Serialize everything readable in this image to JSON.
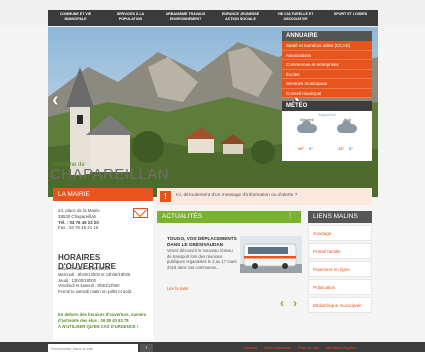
{
  "nav": [
    {
      "line1": "Commune et vie",
      "line2": "municipale"
    },
    {
      "line1": "Services à la",
      "line2": "population"
    },
    {
      "line1": "Urbanisme travaux",
      "line2": "environnement"
    },
    {
      "line1": "Enfance jeunesse",
      "line2": "action sociale"
    },
    {
      "line1": "Vie culturelle et",
      "line2": "associative"
    },
    {
      "line1": "Sport et loisirs",
      "line2": ""
    }
  ],
  "logo": {
    "small": "commune de",
    "big": "CHAPAREILLAN"
  },
  "annuaire": {
    "title": "Annuaire",
    "links": [
      "Santé et numéros utiles (CCAS)",
      "Associations",
      "Commerces et entreprises",
      "Écoles",
      "Services municipaux",
      "Conseil municipal"
    ]
  },
  "meteo": {
    "title": "MÉTÉO",
    "updated": "Aujourd'hui",
    "days": [
      {
        "name": "Mercredi",
        "low": "10°",
        "high": "6°"
      },
      {
        "name": "Jeudi",
        "low": "13°",
        "high": "5°"
      }
    ]
  },
  "mairie": {
    "title": "La mairie",
    "address": [
      "24, place de la Mairie",
      "38530 Chapareillan",
      "Tél. : 04 76 45 22 20",
      "Fax : 04 76 45 21 16"
    ],
    "hours_title": "Horaires d'ouverture",
    "hours": [
      "Lundi et mardi : 8h30/12h00",
      "Mercredi : 8h30/12h00 et 13h30/18h00",
      "Jeudi : 13h00/18h00",
      "Vendredi et samedi : 8h30/12h00",
      "Fermé le samedi matin en juillet et août"
    ],
    "urgence": [
      "En dehors des horaires d'ouverture, numéro",
      "d'astreinte des élus : 06 80 40 83 78",
      "À N'UTILISER QU'EN CAS D'URGENCE !"
    ]
  },
  "alert": {
    "icon": "!",
    "text": "Ici, déroulement d'un message d'information ou d'alerte ?"
  },
  "actualites": {
    "title": "Actualités",
    "dots": "⋮",
    "news_title": "TOUGO, VOS DÉPLACEMENTS DANS LE GRÉSIVAUDAN",
    "news_text": "Venez découvrir le nouveau réseau de transport lors des réunions publiques organisées le 3 au 17 mars 2016 dans vos communes...",
    "more": "Lire la suite",
    "prev": "‹",
    "next": "›"
  },
  "liens": {
    "title": "Liens malins",
    "items": [
      "Sondage",
      "Portail famille",
      "Paiement en ligne",
      "Publication",
      "Bibliothèque municipale"
    ]
  },
  "footer": {
    "search_placeholder": "Rechercher dans le site",
    "search_button": "›",
    "links": [
      "Contact",
      "Géolocalisation",
      "Plan du site",
      "Mentions légales"
    ]
  },
  "hero_arrows": {
    "prev": "‹",
    "next": "›"
  }
}
